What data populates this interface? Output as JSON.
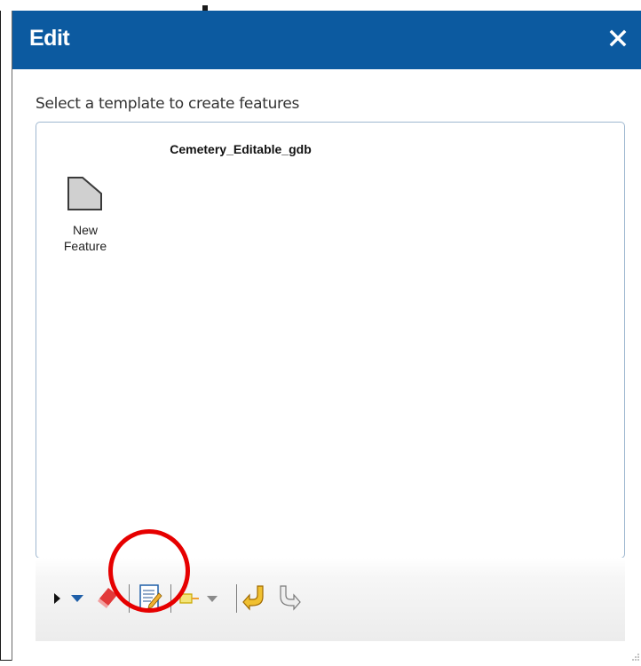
{
  "dialog": {
    "title": "Edit",
    "close_glyph": "✕"
  },
  "template_picker": {
    "prompt": "Select a template to create features",
    "layer_name": "Cemetery_Editable_gdb",
    "templates": [
      {
        "label": "New\nFeature",
        "icon": "polygon-template-icon"
      }
    ]
  },
  "toolbar": {
    "tools": [
      "select-arrow-icon",
      "select-dropdown-icon",
      "eraser-delete-icon",
      "attributes-edit-icon",
      "cut-tool-icon",
      "cut-dropdown-icon",
      "undo-icon",
      "redo-icon"
    ]
  },
  "annotation": {
    "highlight_color": "#e60000"
  },
  "colors": {
    "titlebar": "#0c5aa0",
    "box_border": "#9fb8d0"
  }
}
